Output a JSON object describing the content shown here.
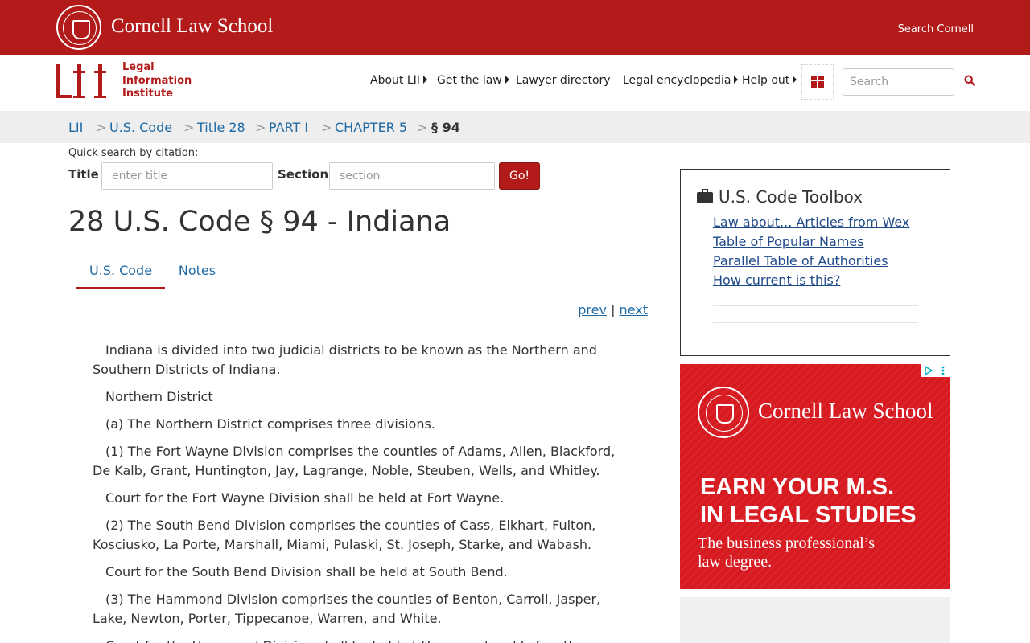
{
  "header": {
    "cornell_name": "Cornell Law School",
    "search_cornell": "Search Cornell"
  },
  "lii": {
    "logo_lines": [
      "Legal",
      "Information",
      "Institute"
    ],
    "nav": [
      {
        "label": "About LII",
        "has_caret": true
      },
      {
        "label": "Get the law",
        "has_caret": true
      },
      {
        "label": "Lawyer directory",
        "has_caret": false
      },
      {
        "label": "Legal encyclopedia",
        "has_caret": true
      },
      {
        "label": "Help out",
        "has_caret": true
      }
    ],
    "search_placeholder": "Search"
  },
  "breadcrumb": {
    "items": [
      "LII",
      "U.S. Code",
      "Title 28",
      "PART I",
      "CHAPTER 5"
    ],
    "current": "§ 94",
    "separator": ">"
  },
  "quick_search": {
    "label": "Quick search by citation:",
    "title_label": "Title",
    "title_placeholder": "enter title",
    "section_label": "Section",
    "section_placeholder": "section",
    "go_label": "Go!"
  },
  "page": {
    "title": "28 U.S. Code § 94 - Indiana",
    "tabs": [
      {
        "label": "U.S. Code",
        "active": true
      },
      {
        "label": "Notes",
        "active": false
      }
    ],
    "prev": "prev",
    "next": "next",
    "pn_sep": "|",
    "paragraphs": [
      "Indiana is divided into two judicial districts to be known as the Northern and Southern Districts of Indiana.",
      "Northern District",
      "(a) The Northern District comprises three divisions.",
      "(1) The Fort Wayne Division comprises the counties of Adams, Allen, Blackford, De Kalb, Grant, Huntington, Jay, Lagrange, Noble, Steuben, Wells, and Whitley.",
      "Court for the Fort Wayne Division shall be held at Fort Wayne.",
      "(2) The South Bend Division comprises the counties of Cass, Elkhart, Fulton, Kosciusko, La Porte, Marshall, Miami, Pulaski, St. Joseph, Starke, and Wabash.",
      "Court for the South Bend Division shall be held at South Bend.",
      "(3) The Hammond Division comprises the counties of Benton, Carroll, Jasper, Lake, Newton, Porter, Tippecanoe, Warren, and White.",
      "Court for the Hammond Division shall be held at Hammond and Lafayette."
    ]
  },
  "toolbox": {
    "title": "U.S. Code Toolbox",
    "links": [
      "Law about... Articles from Wex",
      "Table of Popular Names",
      "Parallel Table of Authorities",
      "How current is this?"
    ]
  },
  "ad": {
    "brand": "Cornell Law School",
    "headline_lines": [
      "EARN YOUR M.S.",
      "IN LEGAL STUDIES"
    ],
    "sub_lines": [
      "The business professional’s",
      "law degree."
    ]
  },
  "colors": {
    "cornell_red": "#b31b1b",
    "link_blue": "#1f6aa5",
    "ad_red": "#d71920"
  }
}
